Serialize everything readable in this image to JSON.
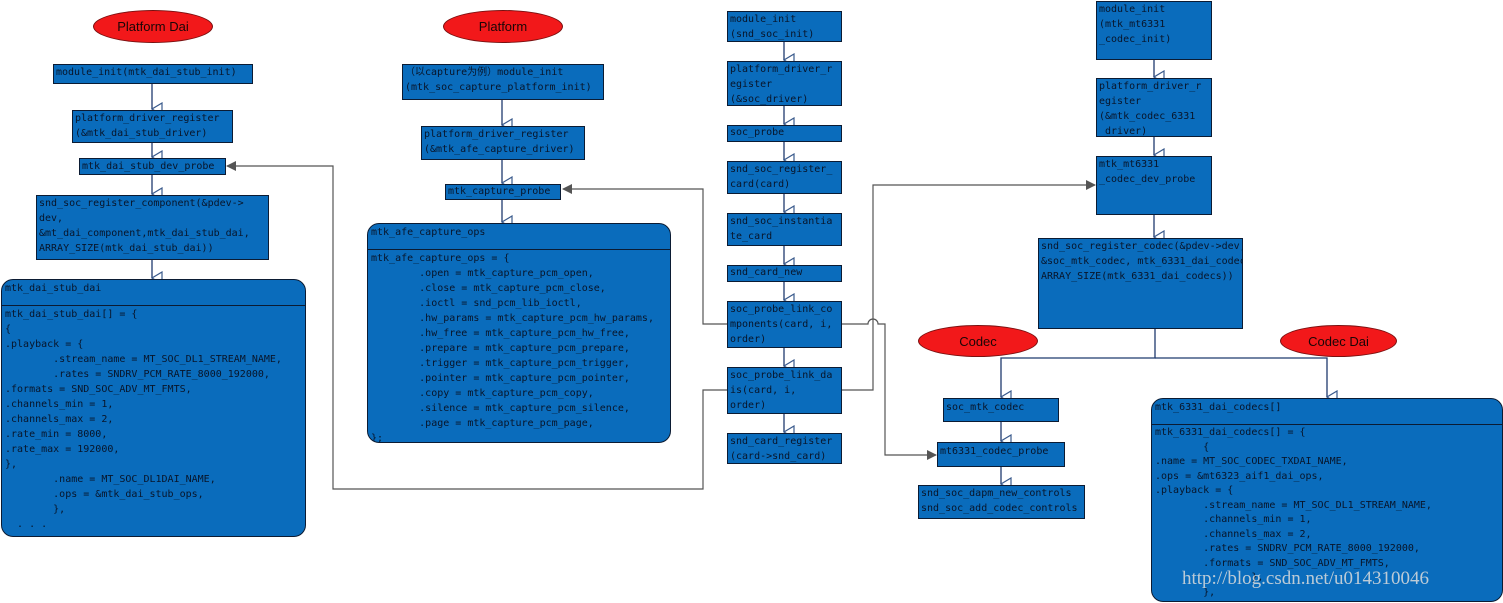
{
  "colors": {
    "box_fill": "#0a6cbc",
    "ellipse_fill": "#f2181a",
    "flow_line": "#1f3a6e",
    "call_line": "#555555"
  },
  "labels": {
    "platform_dai": "Platform Dai",
    "platform": "Platform",
    "codec": "Codec",
    "codec_dai": "Codec Dai"
  },
  "platform_dai": {
    "module_init": [
      "module_init(mtk_dai_stub_init)"
    ],
    "driver_register": [
      "platform_driver_register",
      "(&mtk_dai_stub_driver)"
    ],
    "dev_probe": [
      "mtk_dai_stub_dev_probe"
    ],
    "register_component": [
      "snd_soc_register_component(&pdev->",
      "dev,",
      "&mt_dai_component,mtk_dai_stub_dai,",
      "ARRAY_SIZE(mtk_dai_stub_dai))"
    ],
    "stub_dai": {
      "header": "mtk_dai_stub_dai",
      "lines": [
        "mtk_dai_stub_dai[] = {",
        "{",
        ".playback = {",
        "        .stream_name = MT_SOC_DL1_STREAM_NAME,",
        "        .rates = SNDRV_PCM_RATE_8000_192000,",
        ".formats = SND_SOC_ADV_MT_FMTS,",
        ".channels_min = 1,",
        ".channels_max = 2,",
        ".rate_min = 8000,",
        ".rate_max = 192000,",
        "},",
        "        .name = MT_SOC_DL1DAI_NAME,",
        "        .ops = &mtk_dai_stub_ops,",
        "        },",
        "  . . ."
      ]
    }
  },
  "platform": {
    "module_init": [
      "（以capture为例）module_init",
      "(mtk_soc_capture_platform_init)"
    ],
    "driver_register": [
      "platform_driver_register",
      "(&mtk_afe_capture_driver)"
    ],
    "probe": [
      "mtk_capture_probe"
    ],
    "capture_ops": {
      "header": "mtk_afe_capture_ops",
      "lines": [
        "mtk_afe_capture_ops = {",
        "        .open = mtk_capture_pcm_open,",
        "        .close = mtk_capture_pcm_close,",
        "        .ioctl = snd_pcm_lib_ioctl,",
        "        .hw_params = mtk_capture_pcm_hw_params,",
        "        .hw_free = mtk_capture_pcm_hw_free,",
        "        .prepare = mtk_capture_pcm_prepare,",
        "        .trigger = mtk_capture_pcm_trigger,",
        "        .pointer = mtk_capture_pcm_pointer,",
        "        .copy = mtk_capture_pcm_copy,",
        "        .silence = mtk_capture_pcm_silence,",
        "        .page = mtk_capture_pcm_page,",
        "};"
      ]
    }
  },
  "machine": {
    "module_init": [
      "module_init",
      "(snd_soc_init)"
    ],
    "driver_register": [
      "platform_driver_r",
      "egister",
      "(&soc_driver)"
    ],
    "soc_probe": [
      "soc_probe"
    ],
    "register_card": [
      "snd_soc_register_",
      "card(card)"
    ],
    "instantiate": [
      "snd_soc_instantia",
      "te_card"
    ],
    "card_new": [
      "snd_card_new"
    ],
    "link_components": [
      "soc_probe_link_co",
      "mponents(card, i,",
      "order)"
    ],
    "link_dais": [
      "soc_probe_link_da",
      "is(card, i,",
      "order)"
    ],
    "card_register": [
      "snd_card_register",
      "(card->snd_card)"
    ]
  },
  "codec_driver": {
    "module_init": [
      "module_init",
      "(mtk_mt6331",
      "_codec_init)"
    ],
    "driver_register": [
      "platform_driver_r",
      "egister",
      "(&mtk_codec_6331",
      " driver)"
    ],
    "dev_probe": [
      "mtk_mt6331",
      "_codec_dev_probe"
    ],
    "register_codec": [
      "snd_soc_register_codec(&pdev->dev,",
      "&soc_mtk_codec, mtk_6331_dai_codecs,",
      "ARRAY_SIZE(mtk_6331_dai_codecs))"
    ]
  },
  "codec": {
    "soc_mtk_codec": [
      "soc_mtk_codec"
    ],
    "codec_probe": [
      "mt6331_codec_probe"
    ],
    "controls": [
      "snd_soc_dapm_new_controls",
      "snd_soc_add_codec_controls"
    ]
  },
  "codec_dai": {
    "dai_codecs": {
      "header": "mtk_6331_dai_codecs[]",
      "lines": [
        "mtk_6331_dai_codecs[] = {",
        "        {",
        ".name = MT_SOC_CODEC_TXDAI_NAME,",
        ".ops = &mt6323_aif1_dai_ops,",
        ".playback = {",
        "        .stream_name = MT_SOC_DL1_STREAM_NAME,",
        "        .channels_min = 1,",
        "        .channels_max = 2,",
        "        .rates = SNDRV_PCM_RATE_8000_192000,",
        "        .formats = SND_SOC_ADV_MT_FMTS,",
        "                },",
        "        },"
      ]
    }
  },
  "watermark": "http://blog.csdn.net/u014310046"
}
